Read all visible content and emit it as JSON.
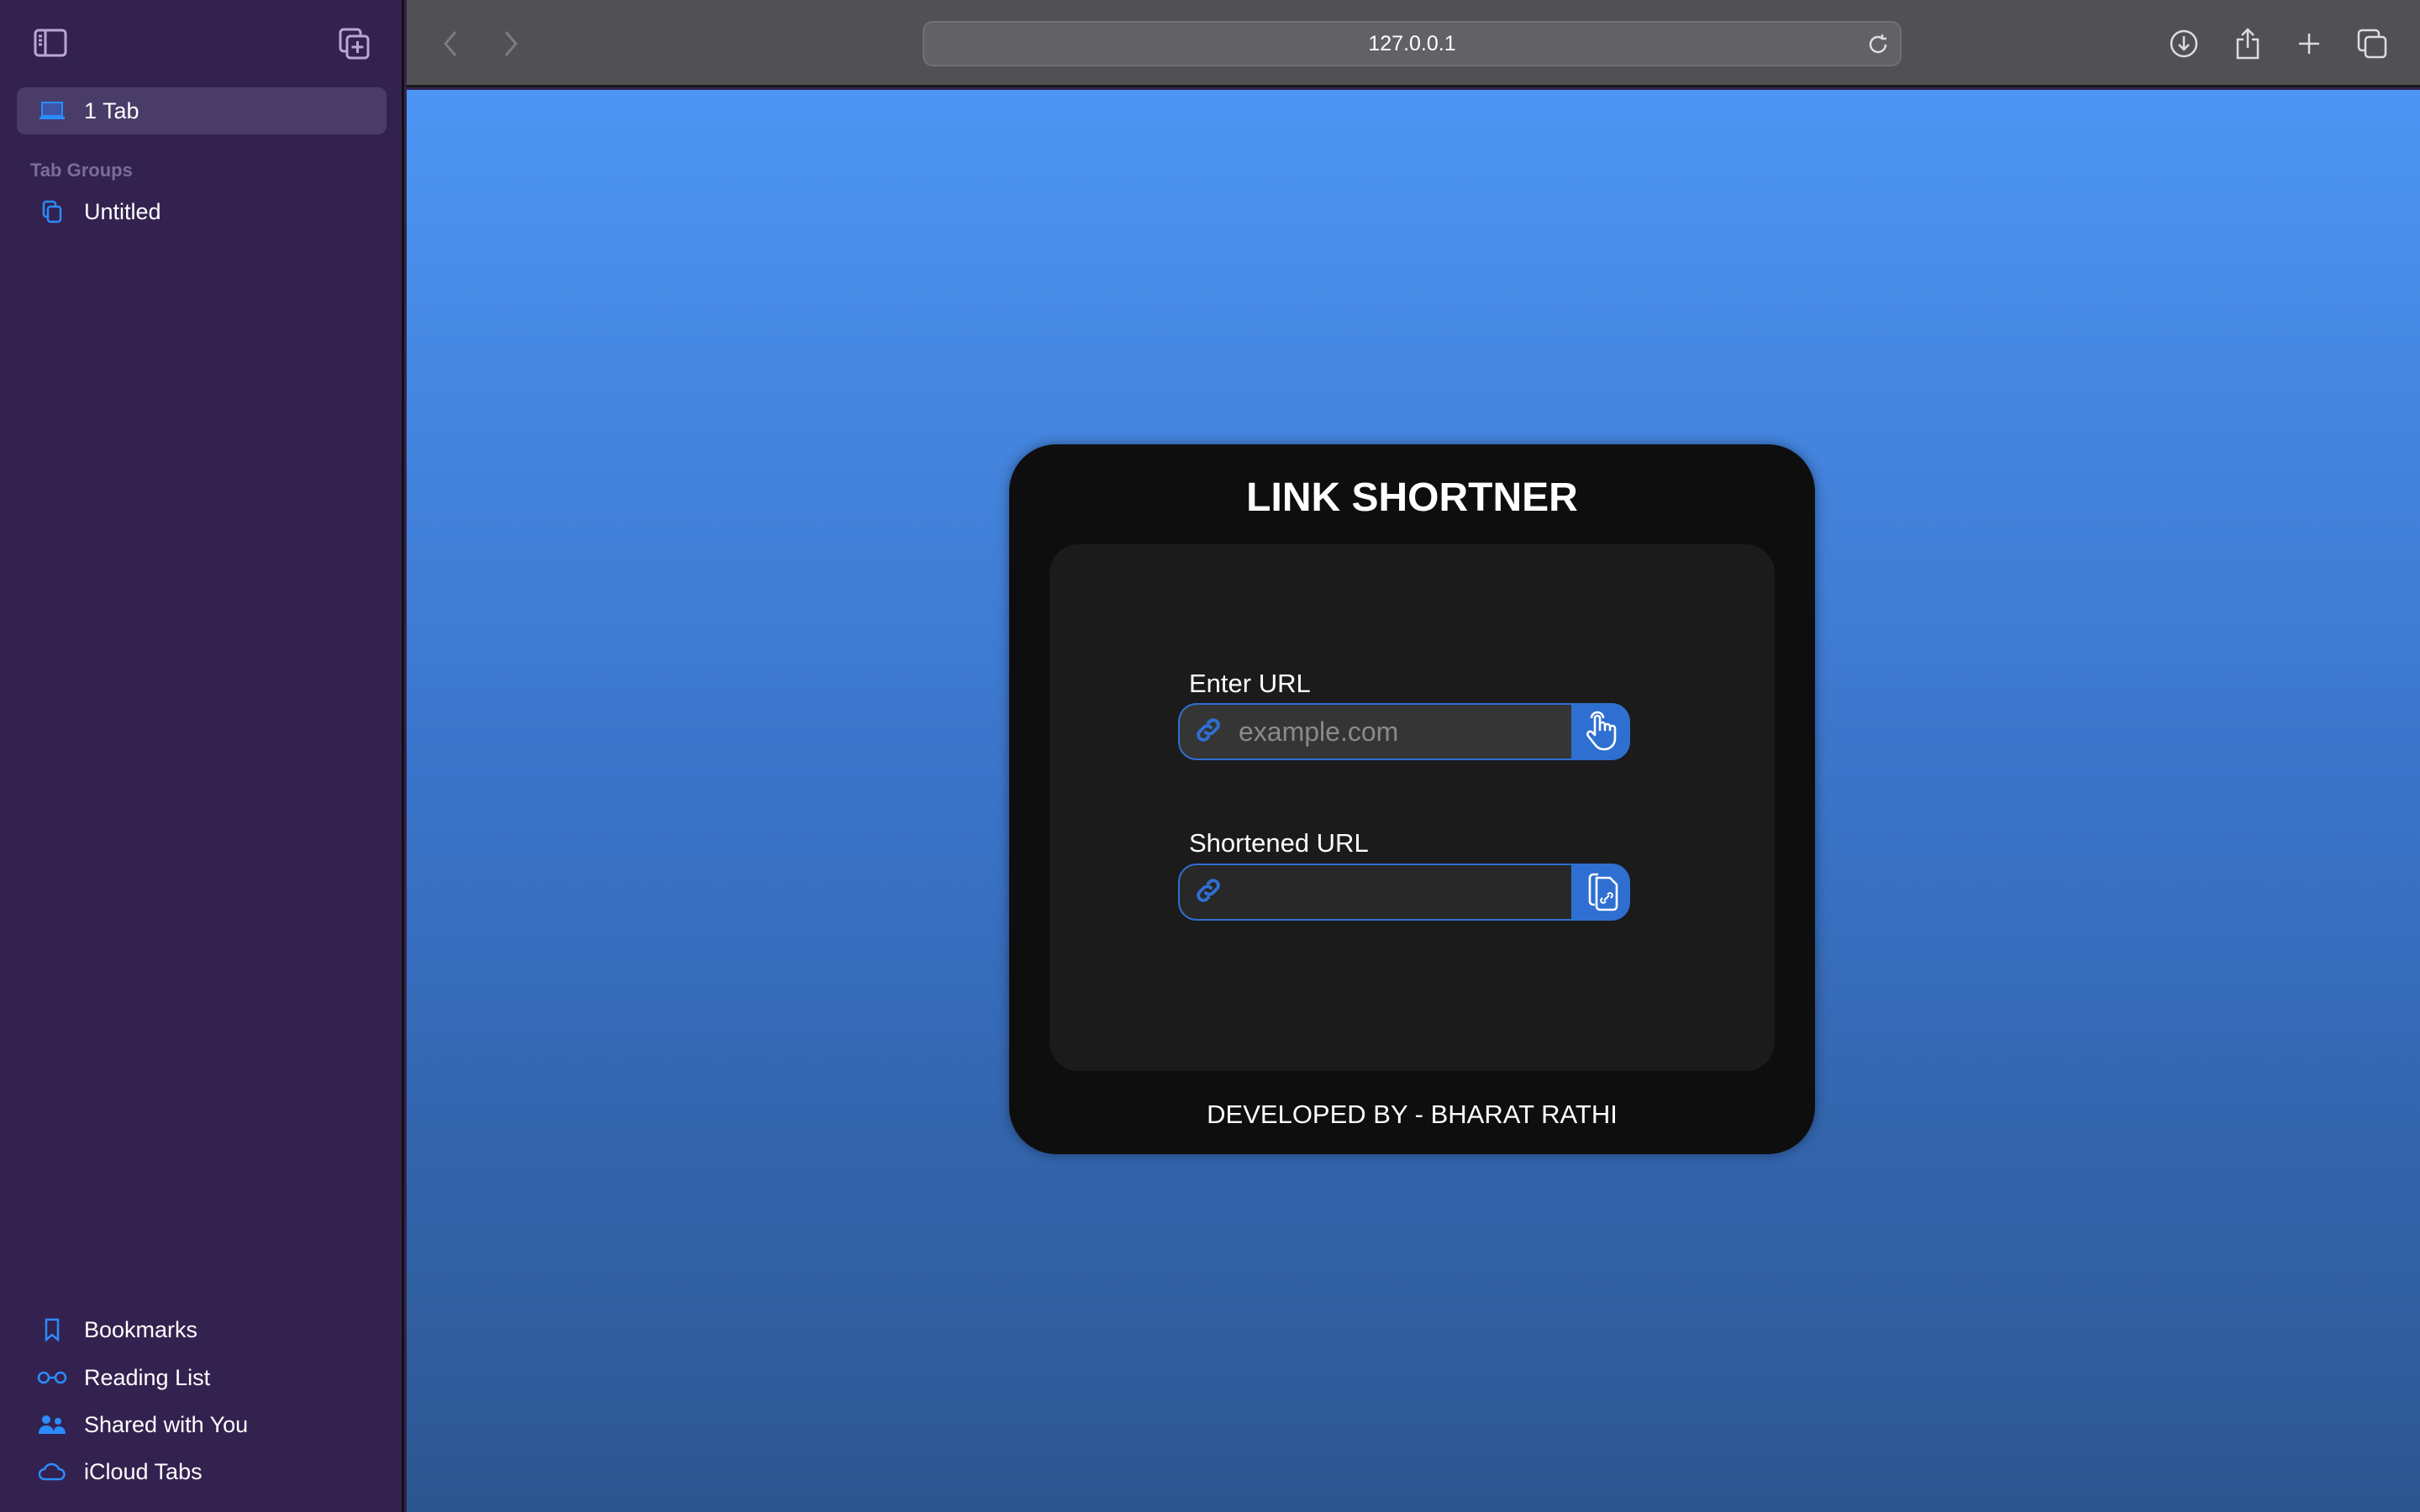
{
  "sidebar": {
    "current": "1 Tab",
    "tab_groups_heading": "Tab Groups",
    "groups": [
      "Untitled"
    ],
    "bottom": [
      {
        "label": "Bookmarks",
        "icon": "bookmark-icon"
      },
      {
        "label": "Reading List",
        "icon": "glasses-icon"
      },
      {
        "label": "Shared with You",
        "icon": "people-icon"
      },
      {
        "label": "iCloud Tabs",
        "icon": "cloud-icon"
      }
    ]
  },
  "toolbar": {
    "address": "127.0.0.1"
  },
  "page": {
    "title": "LINK SHORTNER",
    "enter_label": "Enter URL",
    "enter_placeholder": "example.com",
    "enter_value": "",
    "short_label": "Shortened URL",
    "short_value": "",
    "footer": "DEVELOPED BY - BHARAT RATHI"
  },
  "colors": {
    "accent": "#2f6fd1",
    "card": "#0e0e0e",
    "panel": "#1b1b1b",
    "sidebar": "#33224f"
  }
}
